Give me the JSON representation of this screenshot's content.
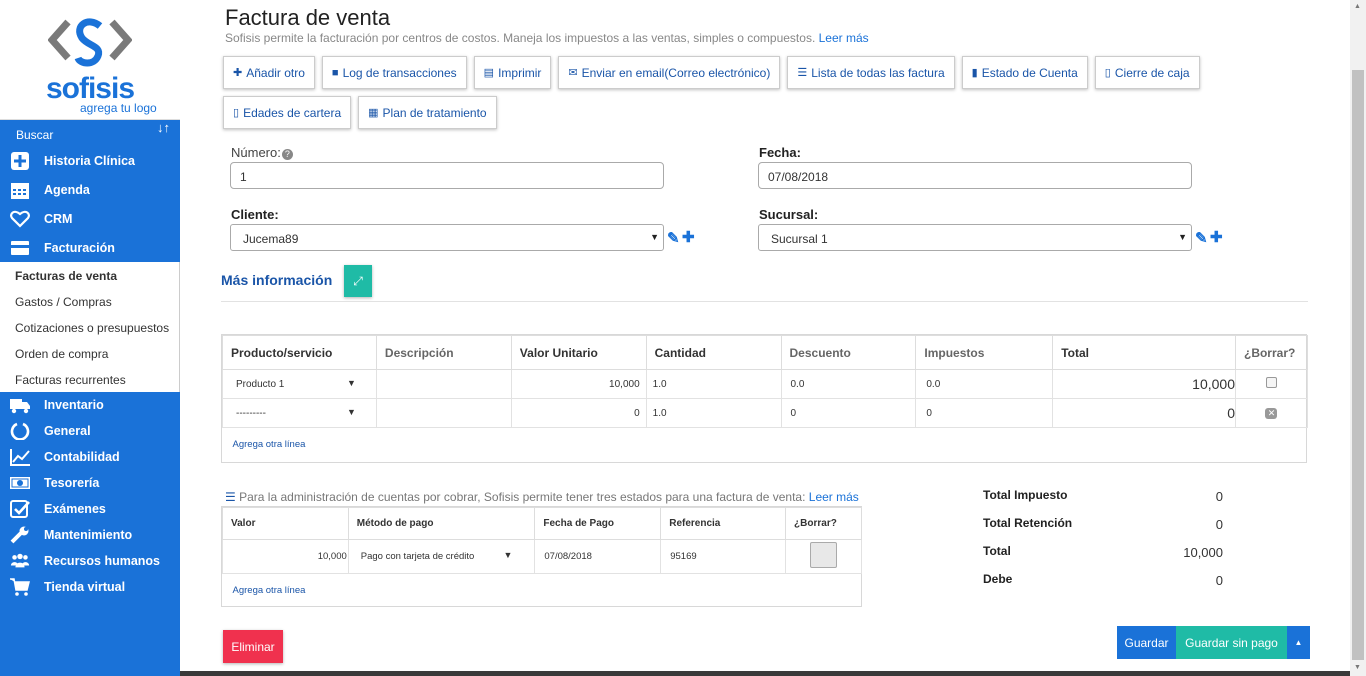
{
  "logo": {
    "brand": "sofisis",
    "tagline": "agrega tu logo"
  },
  "sidebar": {
    "search_label": "Buscar",
    "sort_glyph": "↓↑",
    "items_top": [
      {
        "label": "Historia Clínica",
        "icon": "plus-square-icon"
      },
      {
        "label": "Agenda",
        "icon": "calendar-icon"
      },
      {
        "label": "CRM",
        "icon": "heart-icon"
      },
      {
        "label": "Facturación",
        "icon": "credit-card-icon"
      }
    ],
    "subitems": [
      {
        "label": "Facturas de venta",
        "active": true
      },
      {
        "label": "Gastos / Compras"
      },
      {
        "label": "Cotizaciones o presupuestos"
      },
      {
        "label": "Orden de compra"
      },
      {
        "label": "Facturas recurrentes"
      }
    ],
    "items_bottom": [
      {
        "label": "Inventario",
        "icon": "truck-icon"
      },
      {
        "label": "General",
        "icon": "circle-notch-icon"
      },
      {
        "label": "Contabilidad",
        "icon": "line-chart-icon"
      },
      {
        "label": "Tesorería",
        "icon": "money-icon"
      },
      {
        "label": "Exámenes",
        "icon": "check-square-icon"
      },
      {
        "label": "Mantenimiento",
        "icon": "wrench-icon"
      },
      {
        "label": "Recursos humanos",
        "icon": "users-icon"
      },
      {
        "label": "Tienda virtual",
        "icon": "cart-icon"
      }
    ]
  },
  "page": {
    "title": "Factura de venta",
    "description": "Sofisis permite la facturación por centros de costos. Maneja los impuestos a las ventas, simples o compuestos.",
    "read_more": "Leer más"
  },
  "toolbar": {
    "row1": [
      {
        "label": "Añadir otro",
        "icon": "plus-icon",
        "glyph": "✚"
      },
      {
        "label": "Log de transacciones",
        "icon": "book-icon",
        "glyph": "■"
      },
      {
        "label": "Imprimir",
        "icon": "print-icon",
        "glyph": "▤"
      },
      {
        "label": "Enviar en email(Correo electrónico)",
        "icon": "envelope-icon",
        "glyph": "✉"
      },
      {
        "label": "Lista de todas las factura",
        "icon": "list-icon",
        "glyph": "☰"
      },
      {
        "label": "Estado de Cuenta",
        "icon": "file-icon",
        "glyph": "▮"
      },
      {
        "label": "Cierre de caja",
        "icon": "box-icon",
        "glyph": "▯"
      }
    ],
    "row2": [
      {
        "label": "Edades de cartera",
        "icon": "box-icon",
        "glyph": "▯"
      },
      {
        "label": "Plan de tratamiento",
        "icon": "calculator-icon",
        "glyph": "▦"
      }
    ]
  },
  "form": {
    "numero_label": "Número:",
    "numero_value": "1",
    "fecha_label": "Fecha:",
    "fecha_value": "07/08/2018",
    "cliente_label": "Cliente:",
    "cliente_value": "Jucema89",
    "sucursal_label": "Sucursal:",
    "sucursal_value": "Sucursal 1",
    "more_info": "Más información"
  },
  "products": {
    "headers": [
      "Producto/servicio",
      "Descripción",
      "Valor Unitario",
      "Cantidad",
      "Descuento",
      "Impuestos",
      "Total",
      "¿Borrar?"
    ],
    "rows": [
      {
        "product": "Producto 1",
        "description": "",
        "unit": "10,000",
        "qty": "1.0",
        "discount": "0.0",
        "tax": "0.0",
        "total": "10,000"
      },
      {
        "product": "---------",
        "description": "",
        "unit": "0",
        "qty": "1.0",
        "discount": "0",
        "tax": "0",
        "total": "0"
      }
    ],
    "add_line": "Agrega otra línea"
  },
  "payments": {
    "info": "Para la administración de cuentas por cobrar, Sofisis permite tener tres estados para una factura de venta:",
    "read_more": "Leer más",
    "headers": [
      "Valor",
      "Método de pago",
      "Fecha de Pago",
      "Referencia",
      "¿Borrar?"
    ],
    "rows": [
      {
        "value": "10,000",
        "method": "Pago con tarjeta de crédito",
        "date": "07/08/2018",
        "reference": "95169"
      }
    ],
    "add_line": "Agrega otra línea"
  },
  "summary": [
    {
      "label": "Total Impuesto",
      "value": "0"
    },
    {
      "label": "Total Retención",
      "value": "0"
    },
    {
      "label": "Total",
      "value": "10,000"
    },
    {
      "label": "Debe",
      "value": "0"
    }
  ],
  "actions": {
    "delete": "Eliminar",
    "save": "Guardar",
    "save_unpaid": "Guardar sin pago",
    "caret": "▲"
  },
  "colors": {
    "primary": "#1a72d8",
    "teal": "#1fbba6",
    "danger": "#f0314e"
  }
}
